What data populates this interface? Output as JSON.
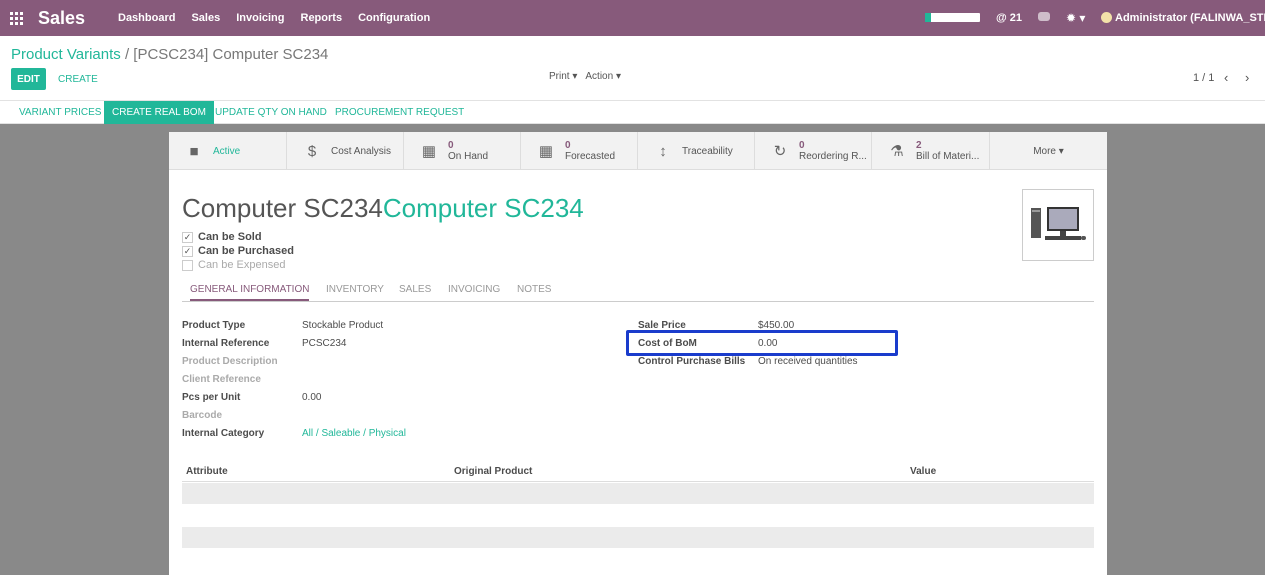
{
  "app": {
    "brand": "Sales",
    "menu": [
      "Dashboard",
      "Sales",
      "Invoicing",
      "Reports",
      "Configuration"
    ],
    "notifications": "@ 21",
    "user": "Administrator (FALINWA_STD)",
    "progress_fraction": 0.1
  },
  "breadcrumb": {
    "parent": "Product Variants",
    "separator": "/",
    "current": "[PCSC234] Computer SC234"
  },
  "control": {
    "edit_label": "EDIT",
    "create_label": "CREATE",
    "print_label": "Print",
    "action_label": "Action",
    "pager": "1 / 1"
  },
  "statusbar": {
    "variant_prices": "VARIANT PRICES",
    "create_real_bom": "CREATE REAL BOM",
    "update_qty": "UPDATE QTY ON HAND",
    "procurement": "PROCUREMENT REQUEST"
  },
  "smart_buttons": {
    "active": "Active",
    "cost_analysis": "Cost Analysis",
    "on_hand_num": "0",
    "on_hand": "On Hand",
    "forecasted_num": "0",
    "forecasted": "Forecasted",
    "traceability": "Traceability",
    "reordering_num": "0",
    "reordering": "Reordering R...",
    "bom_num": "2",
    "bom": "Bill of Materi...",
    "more": "More"
  },
  "product": {
    "name": "Computer SC234",
    "variant_name": "Computer SC234",
    "can_be_sold": "Can be Sold",
    "can_be_purchased": "Can be Purchased",
    "can_be_expensed": "Can be Expensed"
  },
  "tabs": [
    "GENERAL INFORMATION",
    "INVENTORY",
    "SALES",
    "INVOICING",
    "NOTES"
  ],
  "fields_left": {
    "product_type_label": "Product Type",
    "product_type": "Stockable Product",
    "internal_ref_label": "Internal Reference",
    "internal_ref": "PCSC234",
    "product_desc_label": "Product Description",
    "client_ref_label": "Client Reference",
    "pcs_label": "Pcs per Unit",
    "pcs": "0.00",
    "barcode_label": "Barcode",
    "category_label": "Internal Category",
    "category": "All / Saleable / Physical"
  },
  "fields_right": {
    "sale_price_label": "Sale Price",
    "sale_price": "$450.00",
    "cost_bom_label": "Cost of BoM",
    "cost_bom": "0.00",
    "control_bills_label": "Control Purchase Bills",
    "control_bills": "On received quantities"
  },
  "attributes": {
    "col_attribute": "Attribute",
    "col_original": "Original Product",
    "col_value": "Value"
  }
}
